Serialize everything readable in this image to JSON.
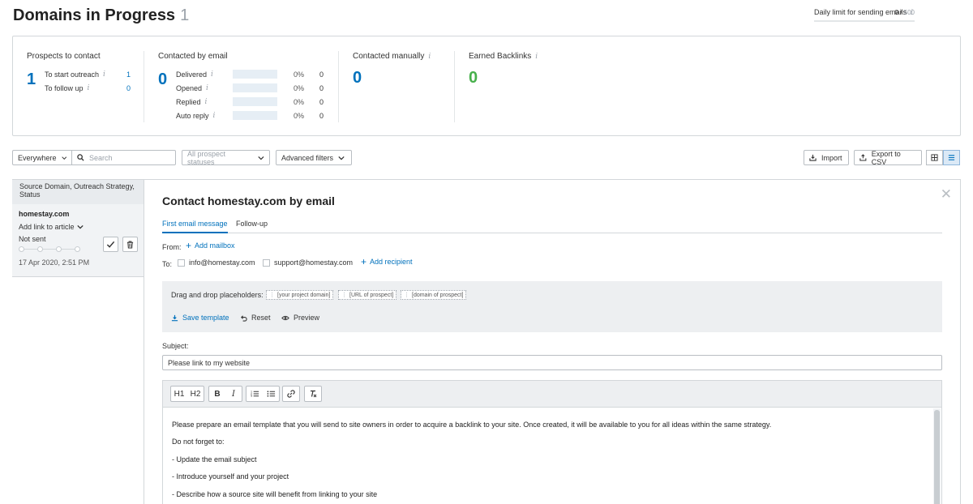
{
  "header": {
    "title": "Domains in Progress",
    "count": "1",
    "daily_limit_label": "Daily limit for sending emails",
    "daily_limit_used": "0",
    "daily_limit_sep": " / ",
    "daily_limit_max": "500",
    "daily_limit_fraction": 0
  },
  "stats": {
    "prospects": {
      "title": "Prospects to contact",
      "total": "1",
      "rows": [
        {
          "label": "To start outreach",
          "value": "1"
        },
        {
          "label": "To follow up",
          "value": "0"
        }
      ]
    },
    "email": {
      "title": "Contacted by email",
      "total": "0",
      "rows": [
        {
          "label": "Delivered",
          "pct": "0%",
          "value": "0"
        },
        {
          "label": "Opened",
          "pct": "0%",
          "value": "0"
        },
        {
          "label": "Replied",
          "pct": "0%",
          "value": "0"
        },
        {
          "label": "Auto reply",
          "pct": "0%",
          "value": "0"
        }
      ]
    },
    "manually": {
      "title": "Contacted manually",
      "total": "0"
    },
    "backlinks": {
      "title": "Earned Backlinks",
      "total": "0"
    }
  },
  "filters": {
    "scope": "Everywhere",
    "search_placeholder": "Search",
    "statuses": "All prospect statuses",
    "advanced": "Advanced filters",
    "import": "Import",
    "export": "Export to CSV"
  },
  "list": {
    "header": "Source Domain, Outreach Strategy, Status",
    "items": [
      {
        "domain": "homestay.com",
        "strategy": "Add link to article",
        "status": "Not sent",
        "date": "17 Apr 2020, 2:51 PM"
      }
    ]
  },
  "panel": {
    "title": "Contact homestay.com by email",
    "tabs": [
      "First email message",
      "Follow-up"
    ],
    "from_label": "From:",
    "add_mailbox": "Add mailbox",
    "to_label": "To:",
    "recipients": [
      "info@homestay.com",
      "support@homestay.com"
    ],
    "add_recipient": "Add recipient",
    "placeholders_label": "Drag and drop placeholders:",
    "placeholders": [
      "[your project domain]",
      "[URL of prospect]",
      "[domain of prospect]"
    ],
    "save_template": "Save template",
    "reset": "Reset",
    "preview": "Preview",
    "subject_label": "Subject:",
    "subject_value": "Please link to my website",
    "toolbar": [
      "H1",
      "H2",
      "B",
      "I",
      "ordered-list",
      "bullet-list",
      "link",
      "clear-format"
    ],
    "body_lines": [
      "Please prepare an email template that you will send to site owners in order to acquire a backlink to your site. Once created, it will be available to you for all ideas within the same strategy.",
      "Do not forget to:",
      "- Update the email subject",
      "- Introduce yourself and your project",
      "- Describe how a source site will benefit from linking to your site"
    ]
  },
  "colors": {
    "accent": "#0071bc",
    "success": "#47b04b",
    "warning": "#f28c00",
    "border": "#d3d7da"
  }
}
